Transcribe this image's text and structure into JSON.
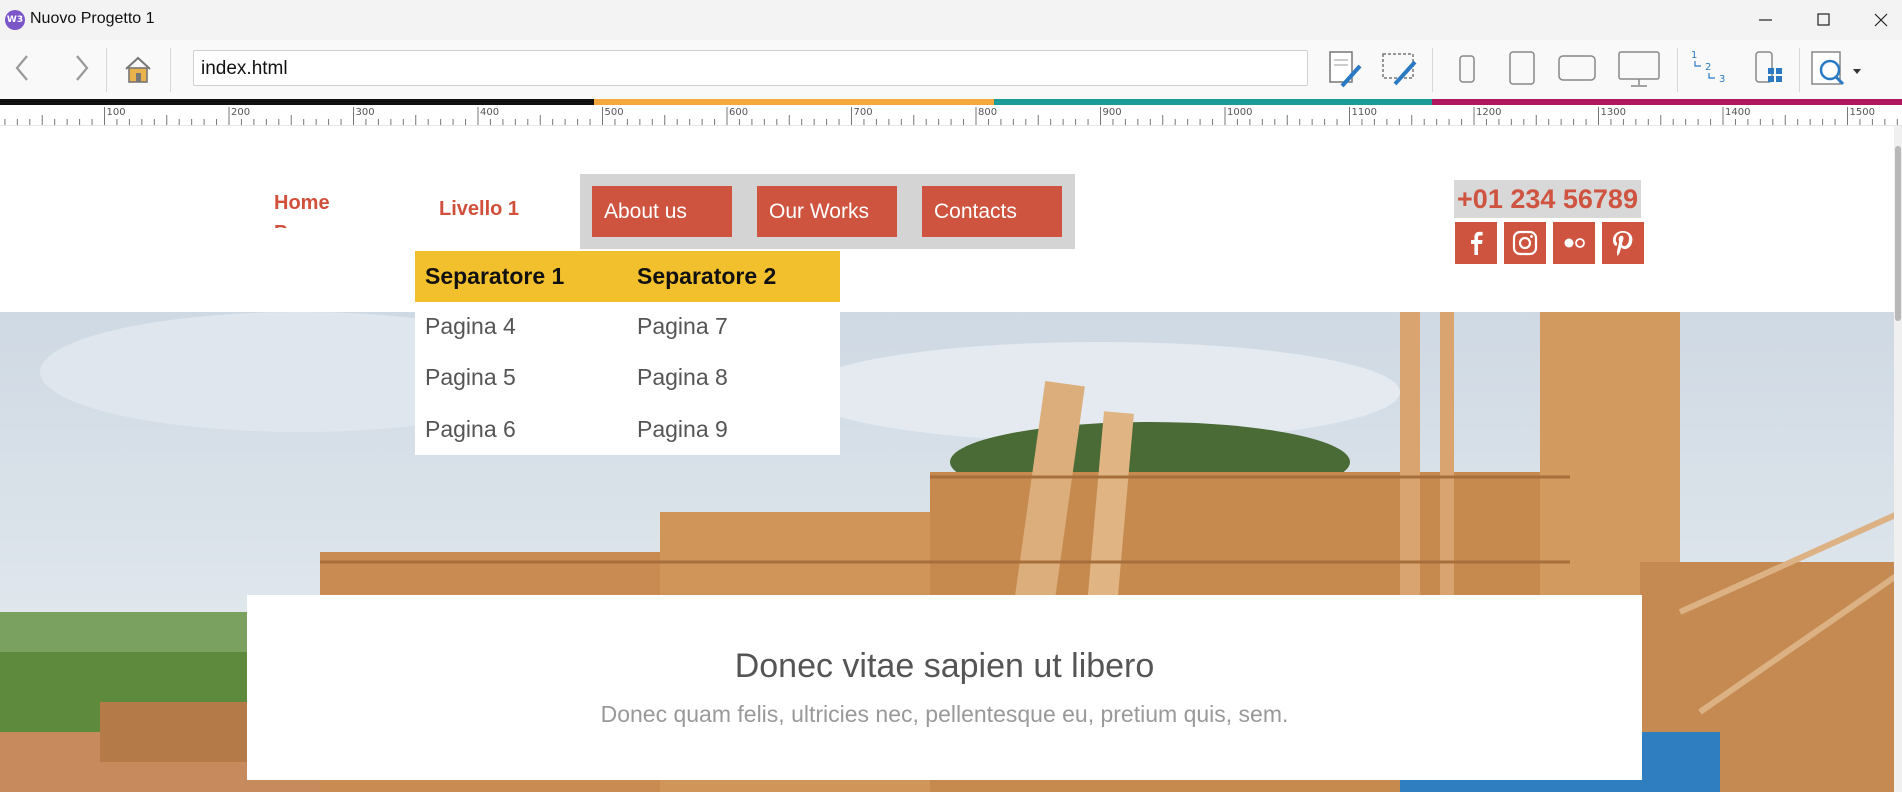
{
  "window": {
    "title": "Nuovo Progetto 1",
    "app_logo": "W3"
  },
  "toolbar": {
    "url_value": "index.html",
    "icons": [
      "back-icon",
      "forward-icon",
      "home-icon",
      "edit-page-icon",
      "edit-selection-icon",
      "phone-portrait-icon",
      "tablet-portrait-icon",
      "tablet-landscape-icon",
      "desktop-icon",
      "numbering-icon",
      "mobile-grid-icon",
      "web-preview-icon",
      "dropdown-arrow-icon"
    ]
  },
  "ruler": {
    "labels": [
      "100",
      "200",
      "300",
      "400",
      "500",
      "600",
      "700",
      "800",
      "900",
      "1000",
      "1100",
      "1200",
      "1300",
      "1400",
      "1500"
    ]
  },
  "site": {
    "nav": {
      "home": "Home Page",
      "livello": "Livello 1",
      "buttons": [
        "About us",
        "Our Works",
        "Contacts"
      ]
    },
    "phone": "+01 234 56789",
    "social_icons": [
      "facebook-icon",
      "instagram-icon",
      "flickr-icon",
      "pinterest-icon"
    ],
    "dropdown": {
      "columns": [
        {
          "header": "Separatore 1",
          "items": [
            "Pagina 4",
            "Pagina 5",
            "Pagina 6"
          ]
        },
        {
          "header": "Separatore 2",
          "items": [
            "Pagina 7",
            "Pagina 8",
            "Pagina 9"
          ]
        }
      ]
    },
    "hero": {
      "title": "Donec vitae sapien ut libero",
      "subtitle": "Donec quam felis, ultricies nec, pellentesque eu, pretium quis, sem."
    }
  },
  "colors": {
    "accent_red": "#cf5440",
    "accent_yellow": "#f2c02d",
    "bar_black": "#111111",
    "bar_orange": "#f5a83c",
    "bar_teal": "#1b9a9a",
    "bar_magenta": "#b0175e"
  }
}
